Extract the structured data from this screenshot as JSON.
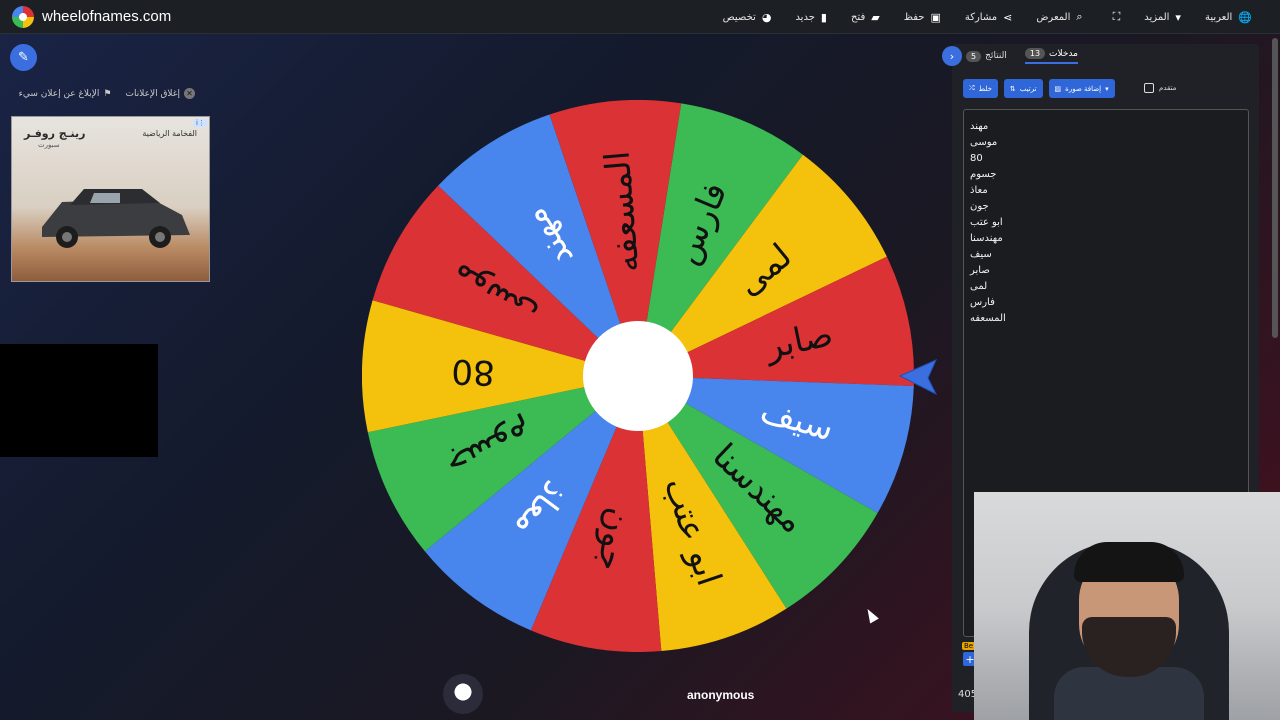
{
  "header": {
    "site_name": "wheelofnames.com",
    "menu": [
      {
        "label": "العربية",
        "icon": "globe-icon",
        "glyph": "🌐"
      },
      {
        "label": "المزيد",
        "icon": "caret-down-icon",
        "glyph": "▾"
      },
      {
        "label": "",
        "icon": "fullscreen-icon",
        "glyph": "⛶"
      },
      {
        "label": "المعرض",
        "icon": "search-icon",
        "glyph": "⌕"
      },
      {
        "label": "مشاركة",
        "icon": "share-icon",
        "glyph": "⋖"
      },
      {
        "label": "حفظ",
        "icon": "save-icon",
        "glyph": "▣"
      },
      {
        "label": "فتح",
        "icon": "folder-icon",
        "glyph": "▰"
      },
      {
        "label": "جديد",
        "icon": "file-icon",
        "glyph": "▮"
      },
      {
        "label": "تخصيص",
        "icon": "palette-icon",
        "glyph": "◕"
      }
    ]
  },
  "ads": {
    "close_label": "إغلاق الإعلانات",
    "report_label": "الإبلاغ عن إعلان سيء",
    "ad_title": "رينـج روفـر",
    "ad_subtitle": "سبورت",
    "ad_brand": "الفخامة الرياضية"
  },
  "wheel": {
    "slices": [
      {
        "label": "فارس",
        "color": "#3cba54"
      },
      {
        "label": "لمى",
        "color": "#f4c20d"
      },
      {
        "label": "صابر",
        "color": "#db3236"
      },
      {
        "label": "سيف",
        "color": "#4885ed"
      },
      {
        "label": "مهندسنا",
        "color": "#3cba54"
      },
      {
        "label": "ابو عتب",
        "color": "#f4c20d"
      },
      {
        "label": "جون",
        "color": "#db3236"
      },
      {
        "label": "معاذ",
        "color": "#4885ed"
      },
      {
        "label": "جسوم",
        "color": "#3cba54"
      },
      {
        "label": "80",
        "color": "#f4c20d"
      },
      {
        "label": "موسى",
        "color": "#db3236"
      },
      {
        "label": "مهند",
        "color": "#4885ed"
      },
      {
        "label": "المسعفه",
        "color": "#db3236"
      }
    ],
    "pointer_color": "#3b6fe0"
  },
  "footer": {
    "username": "anonymous"
  },
  "panel": {
    "tabs": [
      {
        "label": "مدخلات",
        "count": "13"
      },
      {
        "label": "النتائج",
        "count": "5"
      }
    ],
    "toolbar": {
      "shuffle_label": "خلط",
      "sort_label": "ترتيب",
      "add_image_label": "إضافة صورة",
      "advanced_label": "متقدم"
    },
    "entries": [
      "مهند",
      "موسى",
      "80",
      "جسوم",
      "معاذ",
      "جون",
      "ابو عتب",
      "مهندسنا",
      "سيف",
      "صابر",
      "لمى",
      "فارس",
      "المسعفه"
    ],
    "footer_count": "405",
    "be_tag": "Be"
  }
}
